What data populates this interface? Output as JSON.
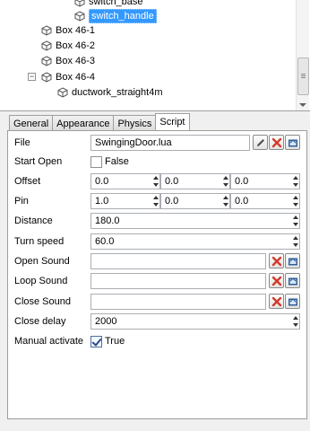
{
  "tree": {
    "items": [
      {
        "label": "switch_base"
      },
      {
        "label": "switch_handle"
      },
      {
        "label": "Box 46-1"
      },
      {
        "label": "Box 46-2"
      },
      {
        "label": "Box 46-3"
      },
      {
        "label": "Box 46-4"
      },
      {
        "label": "ductwork_straight4m"
      }
    ],
    "collapse_glyph": "−"
  },
  "tabs": {
    "general": "General",
    "appearance": "Appearance",
    "physics": "Physics",
    "script": "Script"
  },
  "form": {
    "file": {
      "label": "File",
      "value": "SwingingDoor.lua"
    },
    "start_open": {
      "label": "Start Open",
      "value_label": "False",
      "checked": false
    },
    "offset": {
      "label": "Offset",
      "x": "0.0",
      "y": "0.0",
      "z": "0.0"
    },
    "pin": {
      "label": "Pin",
      "x": "1.0",
      "y": "0.0",
      "z": "0.0"
    },
    "distance": {
      "label": "Distance",
      "value": "180.0"
    },
    "turn_speed": {
      "label": "Turn speed",
      "value": "60.0"
    },
    "open_sound": {
      "label": "Open Sound",
      "value": ""
    },
    "loop_sound": {
      "label": "Loop Sound",
      "value": ""
    },
    "close_sound": {
      "label": "Close Sound",
      "value": ""
    },
    "close_delay": {
      "label": "Close delay",
      "value": "2000"
    },
    "manual_activate": {
      "label": "Manual activate",
      "value_label": "True",
      "checked": true
    }
  },
  "colors": {
    "selection": "#3399ff",
    "clear_red": "#d23b2a",
    "edit_icon": "#4d4d4d",
    "browse_icon": "#2f5f9a"
  },
  "icons": {
    "tree_node": "cube-icon",
    "edit": "pencil-icon",
    "clear": "red-x-icon",
    "browse": "folder-browse-icon"
  }
}
